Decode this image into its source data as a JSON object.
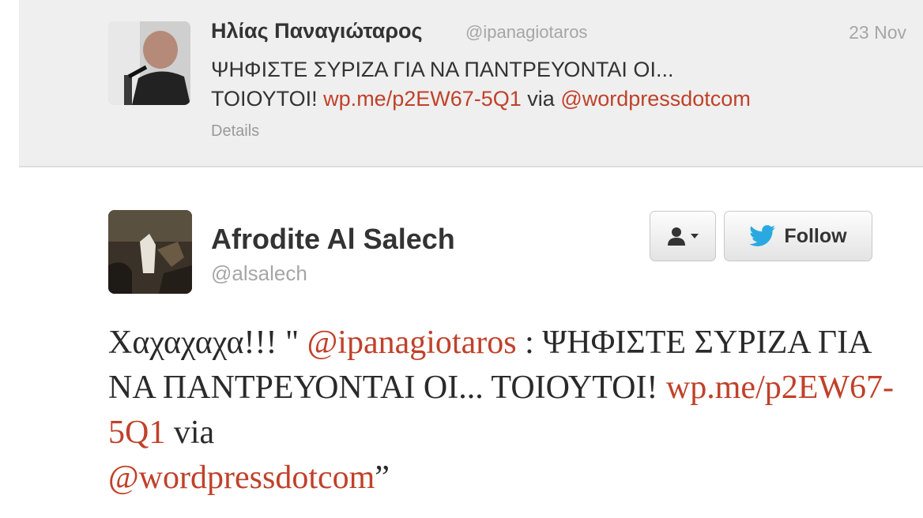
{
  "top_tweet": {
    "author_name": "Ηλίας Παναγιώταρος",
    "author_handle": "@ipanagiotaros",
    "date": "23 Nov",
    "text_line1": "ΨΗΦΙΣΤΕ ΣΥΡΙΖΑ ΓΙΑ ΝΑ ΠΑΝΤΡΕΥΟΝΤΑΙ ΟΙ...",
    "text_line2_prefix": "ΤΟΙΟΥΤΟΙ! ",
    "link": "wp.me/p2EW67-5Q1",
    "via": " via ",
    "mention": "@wordpressdotcom",
    "details_label": "Details"
  },
  "main_tweet": {
    "author_name": "Afrodite Al Salech",
    "author_handle": "@alsalech",
    "follow_label": "Follow",
    "text_start": "Χαχαχαχα!!! \" ",
    "mention1": "@ipanagiotaros",
    "text_mid": " : ΨΗΦΙΣΤΕ ΣΥΡΙΖΑ ΓΙΑ ΝΑ ΠΑΝΤΡΕΥΟΝΤΑΙ ΟΙ... ΤΟΙΟΥΤΟΙ! ",
    "link": "wp.me/p2EW67-5Q1",
    "via": " via ",
    "mention2": "@wordpressdotcom",
    "text_end": "”"
  },
  "colors": {
    "link": "#c0412a",
    "text": "#333333",
    "muted": "#a6a6a6",
    "twitter_bird": "#2aa9e0"
  },
  "icons": {
    "user_menu": "user-dropdown-icon",
    "follow": "twitter-bird-icon"
  }
}
